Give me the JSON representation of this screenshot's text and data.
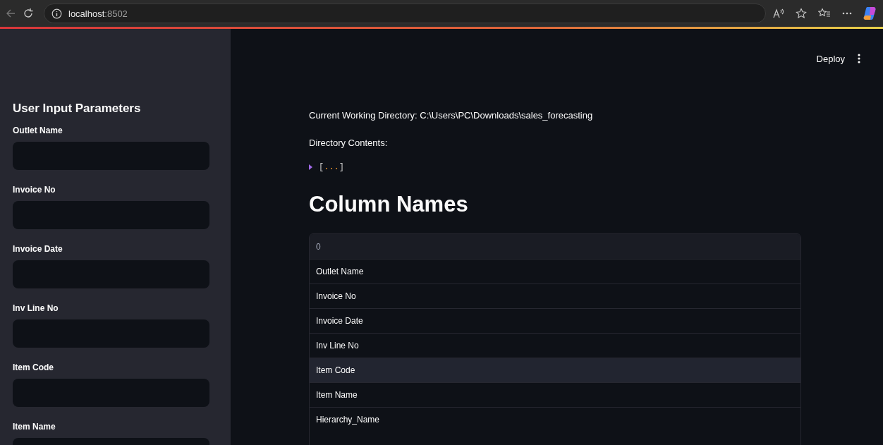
{
  "browser": {
    "address_host": "localhost",
    "address_port": ":8502"
  },
  "header": {
    "deploy_label": "Deploy"
  },
  "sidebar": {
    "title": "User Input Parameters",
    "fields": [
      {
        "label": "Outlet Name"
      },
      {
        "label": "Invoice No"
      },
      {
        "label": "Invoice Date"
      },
      {
        "label": "Inv Line No"
      },
      {
        "label": "Item Code"
      },
      {
        "label": "Item Name"
      }
    ]
  },
  "main": {
    "working_directory": "Current Working Directory: C:\\Users\\PC\\Downloads\\sales_forecasting",
    "contents_label": "Directory Contents:",
    "collapsed_list": {
      "expanded": false,
      "open_bracket": "[",
      "ellipsis": "...",
      "close_bracket": "]"
    },
    "heading": "Column Names"
  },
  "table": {
    "columns": [
      "0"
    ],
    "rows": [
      {
        "cells": [
          "Outlet Name"
        ],
        "highlighted": false
      },
      {
        "cells": [
          "Invoice No"
        ],
        "highlighted": false
      },
      {
        "cells": [
          "Invoice Date"
        ],
        "highlighted": false
      },
      {
        "cells": [
          "Inv Line No"
        ],
        "highlighted": false
      },
      {
        "cells": [
          "Item Code"
        ],
        "highlighted": true
      },
      {
        "cells": [
          "Item Name"
        ],
        "highlighted": false
      },
      {
        "cells": [
          "Hierarchy_Name"
        ],
        "highlighted": false
      }
    ]
  }
}
